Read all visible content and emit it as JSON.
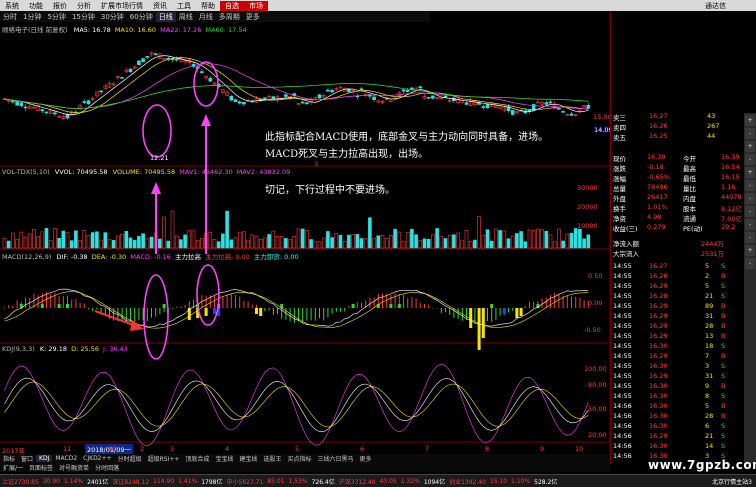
{
  "menu": {
    "items": [
      "系统",
      "功能",
      "报价",
      "分析",
      "扩展市场行情",
      "资讯",
      "工具",
      "帮助"
    ],
    "highlight": [
      "自选",
      "市场"
    ],
    "right_title": "通达信"
  },
  "periods": {
    "items": [
      "分时",
      "1分钟",
      "5分钟",
      "15分钟",
      "30分钟",
      "60分钟",
      "日线",
      "周线",
      "月线",
      "多周期",
      "更多"
    ],
    "active": "日线"
  },
  "stock_header": {
    "name": "顺络电子(日线 前复权)",
    "ma5": "MA5: 16.78",
    "ma10": "MA10: 16.60",
    "ma22": "MA22: 17.26",
    "ma60": "MA60: 17.54"
  },
  "kline": {
    "low_label": "12.21",
    "marker_num": "3"
  },
  "vol_header": {
    "name": "VOL-TDX(5,10)",
    "vvol": "VVOL: 70495.58",
    "volume": "VOLUME: 70495.58",
    "mav1": "MAV1: 46462.30",
    "mav2": "MAV2: 43832.09",
    "axis": [
      "30000",
      "20000",
      "10000"
    ]
  },
  "macd_header": {
    "name": "MACD(12,26,9)",
    "dif": "DIF: -0.38",
    "dea": "DEA: -0.30",
    "macd": "MACD: -0.16",
    "main_up": "主力拉高",
    "main_label": "主力拉高: 0.00",
    "main_label2": "主力卸货: 0.00",
    "axis": [
      "0.50",
      "0.00",
      "-0.50"
    ]
  },
  "kdj_header": {
    "name": "KDJ(9,3,3)",
    "k": "K: 29.18",
    "d": "D: 25.56",
    "j": "J: 36.43",
    "axis": [
      "100.00",
      "80.00",
      "50.00",
      "20.00"
    ]
  },
  "annotations": {
    "line1": "此指标配合MACD使用，底部金叉与主力动向同时具备，进场。",
    "line2": "MACD死叉与主力拉高出现，出场。",
    "line3": "切记，下行过程中不要进场。"
  },
  "xaxis": {
    "year": "2017年",
    "date_box": "2018/01/09一",
    "ticks": [
      "11",
      "12",
      "2",
      "3",
      "4",
      "5",
      "6",
      "7",
      "8",
      "9",
      "10"
    ]
  },
  "price_axis": [
    "15.00",
    "14.09"
  ],
  "orderbook": {
    "rows": [
      {
        "label": "卖三",
        "price": "16.27",
        "vol": "43"
      },
      {
        "label": "卖四",
        "price": "16.26",
        "vol": "267"
      },
      {
        "label": "卖五",
        "price": "16.25",
        "vol": "44"
      }
    ]
  },
  "quote": {
    "rows": [
      {
        "k1": "现价",
        "v1": "16.39",
        "k2": "今开",
        "v2": "16.39"
      },
      {
        "k1": "涨跌",
        "v1": "-0.18",
        "k2": "最高",
        "v2": "16.54"
      },
      {
        "k1": "涨幅",
        "v1": "-0.65%",
        "k2": "最低",
        "v2": "16.15"
      },
      {
        "k1": "总量",
        "v1": "78496",
        "k2": "量比",
        "v2": "1.16"
      },
      {
        "k1": "外盘",
        "v1": "26417",
        "k2": "内盘",
        "v2": "44078"
      },
      {
        "k1": "换手",
        "v1": "1.01%",
        "k2": "股本",
        "v2": "8.12亿"
      },
      {
        "k1": "净资",
        "v1": "4.98",
        "k2": "流通",
        "v2": "7.00亿"
      },
      {
        "k1": "收益(三)",
        "v1": "0.279",
        "k2": "PE(动)",
        "v2": "29.2"
      }
    ],
    "flow1_label": "净流入额",
    "flow1_val": "2444万",
    "flow2_label": "大宗流入",
    "flow2_val": "2531万"
  },
  "ticks": [
    {
      "t": "14:55",
      "p": "16.27",
      "v": "5",
      "s": "S"
    },
    {
      "t": "14:55",
      "p": "16.28",
      "v": "2",
      "s": "B"
    },
    {
      "t": "14:55",
      "p": "16.29",
      "v": "5",
      "s": "S"
    },
    {
      "t": "14:55",
      "p": "16.28",
      "v": "21",
      "s": "S"
    },
    {
      "t": "14:55",
      "p": "16.29",
      "v": "89",
      "s": "B"
    },
    {
      "t": "14:55",
      "p": "16.29",
      "v": "31",
      "s": "B"
    },
    {
      "t": "14:55",
      "p": "16.29",
      "v": "28",
      "s": "B"
    },
    {
      "t": "14:55",
      "p": "16.29",
      "v": "13",
      "s": "B"
    },
    {
      "t": "14:55",
      "p": "16.30",
      "v": "18",
      "s": "S"
    },
    {
      "t": "14:55",
      "p": "16.29",
      "v": "7",
      "s": "B"
    },
    {
      "t": "14:55",
      "p": "16.30",
      "v": "3",
      "s": "S"
    },
    {
      "t": "14:55",
      "p": "16.29",
      "v": "31",
      "s": "S"
    },
    {
      "t": "14:55",
      "p": "16.30",
      "v": "9",
      "s": "B"
    },
    {
      "t": "14:55",
      "p": "16.30",
      "v": "8",
      "s": "S"
    },
    {
      "t": "14:56",
      "p": "16.30",
      "v": "5",
      "s": "B"
    },
    {
      "t": "14:56",
      "p": "16.30",
      "v": "28",
      "s": "B"
    },
    {
      "t": "14:56",
      "p": "16.30",
      "v": "6",
      "s": "S"
    },
    {
      "t": "14:56",
      "p": "16.29",
      "v": "21",
      "s": "S"
    },
    {
      "t": "14:56",
      "p": "16.30",
      "v": "14",
      "s": "S"
    },
    {
      "t": "14:56",
      "p": "16.30",
      "v": "3",
      "s": "S"
    }
  ],
  "bottom_tabs": {
    "row1": [
      "指标",
      "窗口",
      "KDJ",
      "MACD2",
      "CJKD2++",
      "分时超级",
      "超级RSI++",
      "顶底合成",
      "宝宝线",
      "建宝线",
      "选股王",
      "买点指标",
      "三线六日黑马",
      "更多"
    ],
    "active": "KDJ",
    "row2": [
      "扩展/一",
      "页面标签",
      "对号融资单",
      "分时回落"
    ]
  },
  "status": {
    "items": [
      {
        "t": "上证2730.85",
        "c": "red"
      },
      {
        "t": "30.90",
        "c": "red"
      },
      {
        "t": "1.14%",
        "c": "red"
      },
      {
        "t": "2401亿",
        "c": "white"
      },
      {
        "t": "深证8248.12",
        "c": "red"
      },
      {
        "t": "114.90",
        "c": "red"
      },
      {
        "t": "1.41%",
        "c": "red"
      },
      {
        "t": "1798亿",
        "c": "white"
      },
      {
        "t": "中小5627.71",
        "c": "red"
      },
      {
        "t": "85.01",
        "c": "red"
      },
      {
        "t": "1.53%",
        "c": "red"
      },
      {
        "t": "726.4亿",
        "c": "white"
      },
      {
        "t": "沪深3312.48",
        "c": "red"
      },
      {
        "t": "43.05",
        "c": "red"
      },
      {
        "t": "1.32%",
        "c": "red"
      },
      {
        "t": "1094亿",
        "c": "white"
      },
      {
        "t": "创业1392.40",
        "c": "red"
      },
      {
        "t": "15.10",
        "c": "red"
      },
      {
        "t": "1.10%",
        "c": "red"
      },
      {
        "t": "528.2亿",
        "c": "white"
      }
    ],
    "right": "北京行情主站3"
  },
  "watermark": "www.7gpzb.com",
  "scroll_btns": [
    "+",
    "-",
    "+",
    "-",
    "+",
    "-",
    "-",
    "-",
    "-",
    "-",
    "+",
    "-"
  ]
}
